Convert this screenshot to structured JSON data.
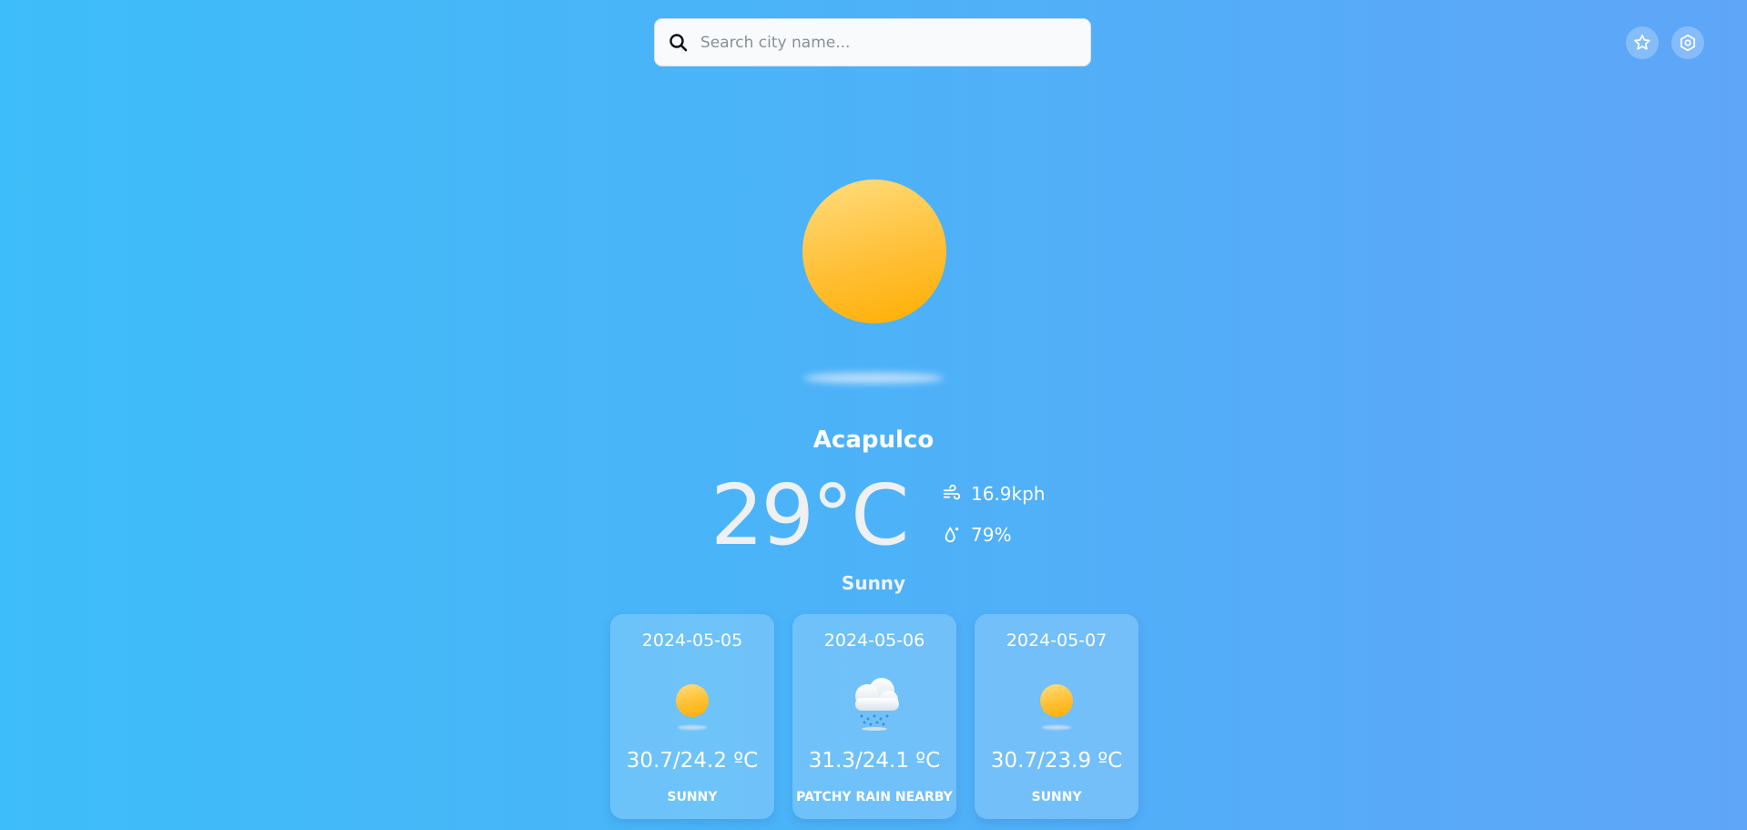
{
  "search": {
    "placeholder": "Search city name..."
  },
  "toolbar": {
    "favorites_icon": "star-icon",
    "settings_icon": "gear-icon"
  },
  "current": {
    "icon": "sun-icon",
    "city": "Acapulco",
    "temperature": "29°C",
    "wind": "16.9kph",
    "humidity": "79%",
    "condition": "Sunny"
  },
  "forecast": [
    {
      "date": "2024-05-05",
      "icon": "sun-icon",
      "range": "30.7/24.2 ºC",
      "condition": "SUNNY"
    },
    {
      "date": "2024-05-06",
      "icon": "cloud-rain-icon",
      "range": "31.3/24.1 ºC",
      "condition": "PATCHY RAIN NEARBY"
    },
    {
      "date": "2024-05-07",
      "icon": "sun-icon",
      "range": "30.7/23.9 ºC",
      "condition": "SUNNY"
    }
  ],
  "colors": {
    "sun": "#ffb300",
    "background_start": "#3dbdf9",
    "background_end": "#5fa5f8"
  }
}
